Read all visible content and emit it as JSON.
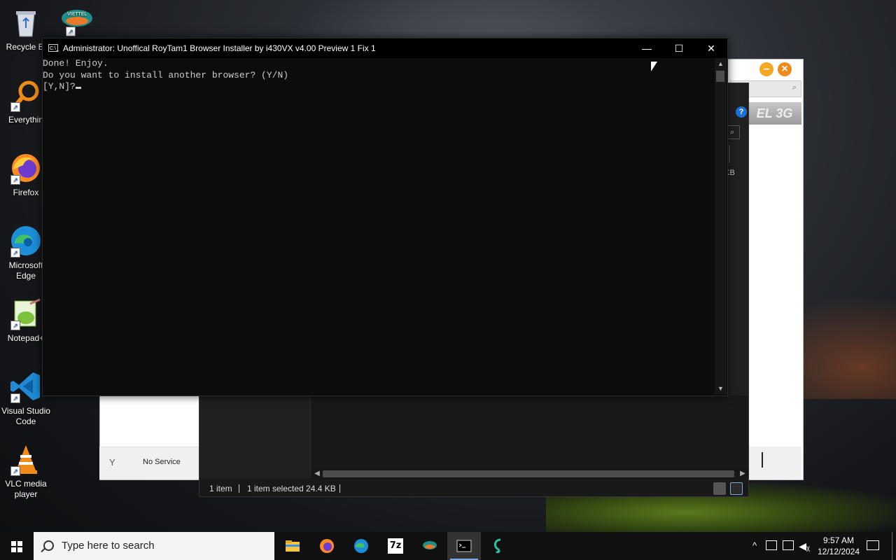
{
  "desktop": {
    "icons": [
      {
        "label": "Recycle Bi",
        "icon": "recycle-bin-icon"
      },
      {
        "label": "Everythin",
        "icon": "everything-search-icon"
      },
      {
        "label": "Firefox",
        "icon": "firefox-icon"
      },
      {
        "label": "Microsoft\nEdge",
        "icon": "edge-icon"
      },
      {
        "label": "Notepad+",
        "icon": "notepad-plus-plus-icon"
      },
      {
        "label": "Visual Studio\nCode",
        "icon": "vscode-icon"
      },
      {
        "label": "VLC media\nplayer",
        "icon": "vlc-icon"
      }
    ]
  },
  "console": {
    "title": "Administrator:  Unoffical RoyTam1 Browser Installer by i430VX v4.00 Preview 1 Fix 1",
    "icon_text": "C:\\_",
    "minimize": "—",
    "maximize": "☐",
    "close": "✕",
    "lines": [
      "Done! Enjoy.",
      "Do you want to install another browser? (Y/N)",
      "[Y,N]?"
    ]
  },
  "background_window": {
    "banner_text": "EL 3G",
    "size_text": "KB",
    "status_text": "No Service"
  },
  "explorer": {
    "status_count": "1 item",
    "status_selected": "1 item selected  24.4 KB"
  },
  "taskbar": {
    "search_placeholder": "Type here to search",
    "apps": [
      {
        "name": "file-explorer",
        "icon": "folder-icon"
      },
      {
        "name": "firefox",
        "icon": "firefox-icon"
      },
      {
        "name": "edge",
        "icon": "edge-icon"
      },
      {
        "name": "7zip",
        "icon": "7zip-icon",
        "text": "7z"
      },
      {
        "name": "viettel",
        "icon": "viettel-icon"
      },
      {
        "name": "console",
        "icon": "console-icon"
      },
      {
        "name": "app",
        "icon": "seahorse-icon"
      }
    ],
    "clock_time": "9:57 AM",
    "clock_date": "12/12/2024"
  },
  "colors": {
    "console_bg": "#0c0c0c",
    "console_text": "#cccccc",
    "taskbar_bg": "#101010",
    "accent": "#7aa8e0"
  }
}
